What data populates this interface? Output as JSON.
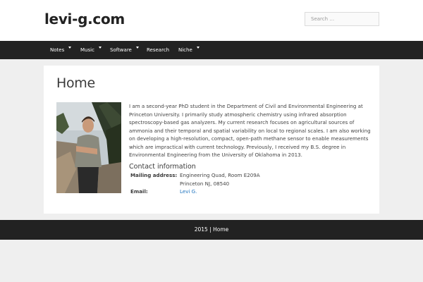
{
  "header": {
    "site_title": "levi-g.com",
    "search_placeholder": "Search …"
  },
  "nav": {
    "items": [
      {
        "label": "Notes",
        "has_dropdown": true
      },
      {
        "label": "Music",
        "has_dropdown": true
      },
      {
        "label": "Software",
        "has_dropdown": true
      },
      {
        "label": "Research",
        "has_dropdown": false
      },
      {
        "label": "Niche",
        "has_dropdown": true
      }
    ]
  },
  "main": {
    "page_title": "Home",
    "bio": "I am a second-year PhD student in the Department of Civil and Environmental Engineering at Princeton University. I primarily study atmospheric chemistry using infrared absorption spectroscopy-based gas analyzers. My current research focuses on agricultural sources of ammonia and their temporal and spatial variability on local to regional scales. I am also working on developing a high-resolution, compact, open-path methane sensor to enable measurements which are impractical with current technology. Previously, I received my B.S. degree in Environmental Engineering from the University of Oklahoma in 2013.",
    "contact": {
      "heading": "Contact information",
      "mailing_label": "Mailing address:",
      "mailing_line1": "Engineering Quad, Room E209A",
      "mailing_line2": "Princeton NJ, 08540",
      "email_label": "Email:",
      "email_value": "Levi G."
    }
  },
  "footer": {
    "text": "2015 | Home"
  },
  "colors": {
    "nav_background": "#222222",
    "page_background": "#efefef",
    "link": "#1e73be"
  }
}
